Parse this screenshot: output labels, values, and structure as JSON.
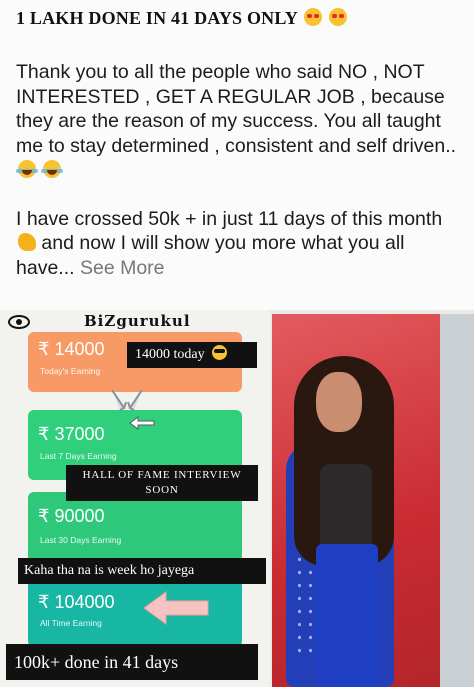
{
  "post": {
    "headline": "1 LAKH DONE IN 41 DAYS ONLY",
    "paragraph1": "Thank you to all the people who said NO , NOT INTERESTED , GET A REGULAR JOB , because they are the reason of my success. You all taught me to stay determined , consistent and self driven..",
    "paragraph2_a": "I have crossed 50k + in just 11 days of this month",
    "paragraph2_b": "and now I will show you more what you all have...",
    "see_more": "See More"
  },
  "image": {
    "brand": "BiZgurukul",
    "cards": [
      {
        "amount": "₹ 14000",
        "sub": "Today's Earning",
        "color": "#f79a66"
      },
      {
        "amount": "₹ 37000",
        "sub": "Last 7 Days Earning",
        "color": "#2fcf7c"
      },
      {
        "amount": "₹ 90000",
        "sub": "Last 30 Days Earning",
        "color": "#2ec87a"
      },
      {
        "amount": "₹ 104000",
        "sub": "All Time Earning",
        "color": "#17b7a4"
      }
    ],
    "labels": {
      "today": "14000 today",
      "hof_line1": "HALL OF FAME INTERVIEW",
      "hof_line2": "SOON",
      "kaha": "Kaha tha na is week ho jayega",
      "done": "100k+ done in 41 days"
    },
    "icons": [
      "heart-eyes-emoji",
      "laughing-emoji",
      "flexed-biceps-emoji",
      "sunglasses-emoji",
      "eye-icon"
    ]
  }
}
